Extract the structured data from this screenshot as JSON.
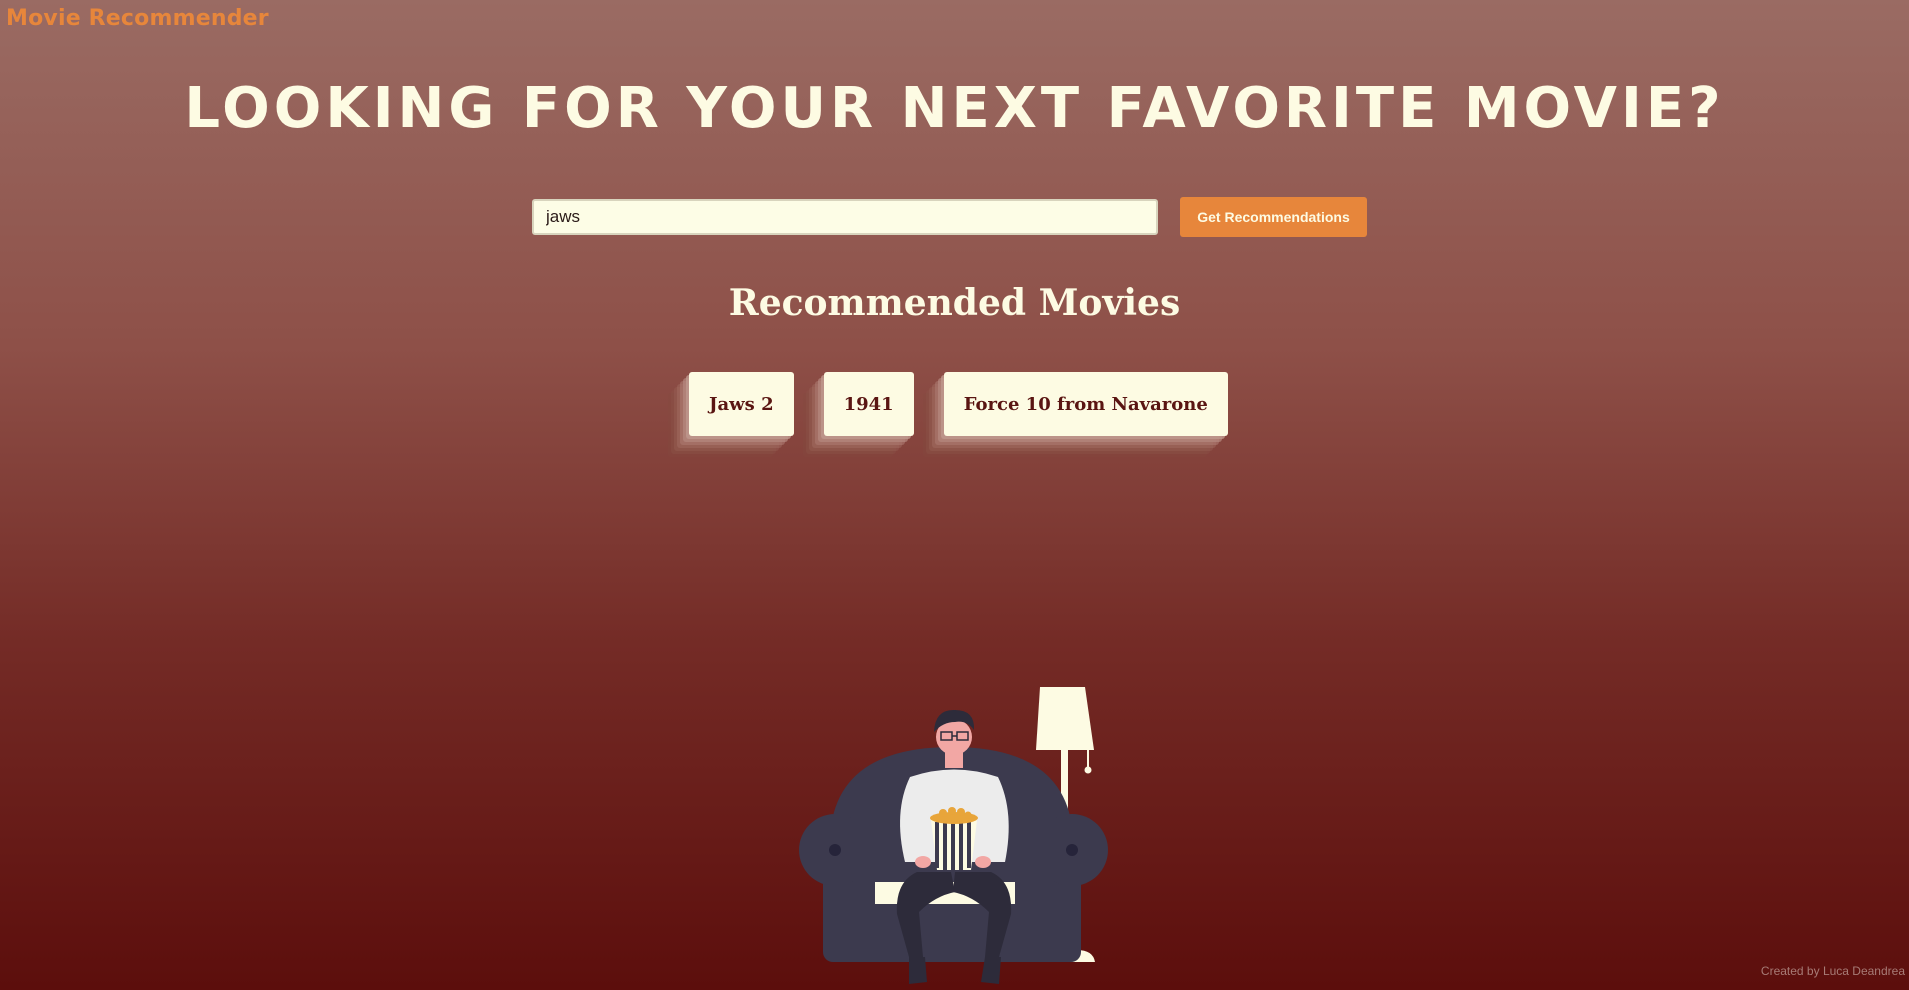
{
  "header": {
    "brand": "Movie Recommender"
  },
  "hero": {
    "title": "Looking for your next favorite movie?"
  },
  "search": {
    "value": "jaws",
    "button_label": "Get Recommendations"
  },
  "results": {
    "heading": "Recommended Movies",
    "movies": [
      "Jaws 2",
      "1941",
      "Force 10 from Navarone"
    ]
  },
  "footer": {
    "credit": "Created by Luca Deandrea"
  },
  "colors": {
    "accent": "#e7863b",
    "cream": "#fdfbe3",
    "card_text": "#5a1512"
  }
}
